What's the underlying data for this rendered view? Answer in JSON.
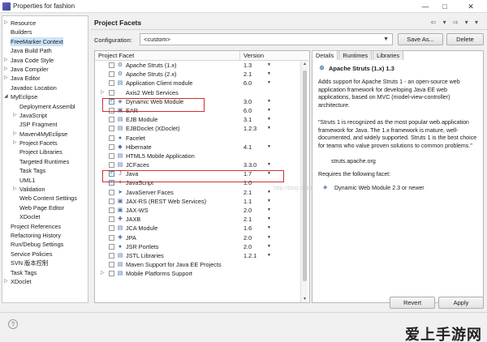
{
  "window": {
    "title": "Properties for fashion",
    "min": "—",
    "max": "□",
    "close": "✕"
  },
  "tree": [
    {
      "label": "Resource",
      "twisty": "▷",
      "indent": 0
    },
    {
      "label": "Builders",
      "twisty": "",
      "indent": 0
    },
    {
      "label": "FreeMarker Context",
      "twisty": "",
      "indent": 0,
      "selected": true
    },
    {
      "label": "Java Build Path",
      "twisty": "",
      "indent": 0
    },
    {
      "label": "Java Code Style",
      "twisty": "▷",
      "indent": 0
    },
    {
      "label": "Java Compiler",
      "twisty": "▷",
      "indent": 0
    },
    {
      "label": "Java Editor",
      "twisty": "▷",
      "indent": 0
    },
    {
      "label": "Javadoc Location",
      "twisty": "",
      "indent": 0
    },
    {
      "label": "MyEclipse",
      "twisty": "◢",
      "indent": 0
    },
    {
      "label": "Deployment Assembl",
      "twisty": "",
      "indent": 1
    },
    {
      "label": "JavaScript",
      "twisty": "▷",
      "indent": 1
    },
    {
      "label": "JSP Fragment",
      "twisty": "",
      "indent": 1
    },
    {
      "label": "Maven4MyEclipse",
      "twisty": "▷",
      "indent": 1
    },
    {
      "label": "Project Facets",
      "twisty": "▷",
      "indent": 1
    },
    {
      "label": "Project Libraries",
      "twisty": "",
      "indent": 1
    },
    {
      "label": "Targeted Runtimes",
      "twisty": "",
      "indent": 1
    },
    {
      "label": "Task Tags",
      "twisty": "",
      "indent": 1
    },
    {
      "label": "UML1",
      "twisty": "",
      "indent": 1
    },
    {
      "label": "Validation",
      "twisty": "▷",
      "indent": 1
    },
    {
      "label": "Web Content Settings",
      "twisty": "",
      "indent": 1
    },
    {
      "label": "Web Page Editor",
      "twisty": "",
      "indent": 1
    },
    {
      "label": "XDoclet",
      "twisty": "",
      "indent": 1
    },
    {
      "label": "Project References",
      "twisty": "",
      "indent": 0
    },
    {
      "label": "Refactoring History",
      "twisty": "",
      "indent": 0
    },
    {
      "label": "Run/Debug Settings",
      "twisty": "",
      "indent": 0
    },
    {
      "label": "Service Policies",
      "twisty": "",
      "indent": 0
    },
    {
      "label": "SVN 版本控制",
      "twisty": "",
      "indent": 0
    },
    {
      "label": "Task Tags",
      "twisty": "",
      "indent": 0
    },
    {
      "label": "XDoclet",
      "twisty": "▷",
      "indent": 0
    }
  ],
  "page": {
    "title": "Project Facets",
    "config_label": "Configuration:",
    "config_value": "<custom>",
    "save_as": "Save As...",
    "delete": "Delete",
    "col_facet": "Project Facet",
    "col_version": "Version"
  },
  "facets": [
    {
      "name": "Apache Struts (1.x)",
      "version": "1.3",
      "checked": false,
      "icon": "⚙",
      "dd": true
    },
    {
      "name": "Apache Struts (2.x)",
      "version": "2.1",
      "checked": false,
      "icon": "⚙",
      "dd": true
    },
    {
      "name": "Application Client module",
      "version": "6.0",
      "checked": false,
      "icon": "▤",
      "dd": true
    },
    {
      "name": "Axis2 Web Services",
      "version": "",
      "checked": false,
      "icon": "",
      "twisty": "▷"
    },
    {
      "name": "Dynamic Web Module",
      "version": "3.0",
      "checked": true,
      "icon": "◈",
      "dd": true
    },
    {
      "name": "EAR",
      "version": "6.0",
      "checked": false,
      "icon": "▣",
      "dd": true
    },
    {
      "name": "EJB Module",
      "version": "3.1",
      "checked": false,
      "icon": "▤",
      "dd": true
    },
    {
      "name": "EJBDoclet (XDoclet)",
      "version": "1.2.3",
      "checked": false,
      "icon": "▤",
      "dd": true
    },
    {
      "name": "Facelet",
      "version": "",
      "checked": false,
      "icon": "●"
    },
    {
      "name": "Hibernate",
      "version": "4.1",
      "checked": false,
      "icon": "◆",
      "dd": true
    },
    {
      "name": "HTML5 Mobile Application",
      "version": "",
      "checked": false,
      "icon": "▤"
    },
    {
      "name": "JCFaces",
      "version": "3.3.0",
      "checked": false,
      "icon": "▤",
      "dd": true
    },
    {
      "name": "Java",
      "version": "1.7",
      "checked": true,
      "icon": "J",
      "dd": true
    },
    {
      "name": "JavaScript",
      "version": "1.0",
      "checked": true,
      "icon": "✦"
    },
    {
      "name": "JavaServer Faces",
      "version": "2.1",
      "checked": false,
      "icon": "➤",
      "dd": true
    },
    {
      "name": "JAX-RS (REST Web Services)",
      "version": "1.1",
      "checked": false,
      "icon": "▣",
      "dd": true
    },
    {
      "name": "JAX-WS",
      "version": "2.0",
      "checked": false,
      "icon": "▣",
      "dd": true
    },
    {
      "name": "JAXB",
      "version": "2.1",
      "checked": false,
      "icon": "✚",
      "dd": true
    },
    {
      "name": "JCA Module",
      "version": "1.6",
      "checked": false,
      "icon": "▤",
      "dd": true
    },
    {
      "name": "JPA",
      "version": "2.0",
      "checked": false,
      "icon": "✚",
      "dd": true
    },
    {
      "name": "JSR Portlets",
      "version": "2.0",
      "checked": false,
      "icon": "●",
      "dd": true
    },
    {
      "name": "JSTL Libraries",
      "version": "1.2.1",
      "checked": false,
      "icon": "▤",
      "dd": true
    },
    {
      "name": "Maven Support for Java EE Projects",
      "version": "",
      "checked": false,
      "icon": "▤"
    },
    {
      "name": "Mobile Platforms Support",
      "version": "",
      "checked": false,
      "icon": "▤",
      "twisty": "▷"
    }
  ],
  "tabs": [
    "Details",
    "Runtimes",
    "Libraries"
  ],
  "details": {
    "heading": "Apache Struts (1.x) 1.3",
    "p1": "Adds support for Apache Struts 1 - an open-source web application framework for developing Java EE web applications, based on MVC (model-view-controller) architecture.",
    "p2": "\"Struts 1 is recognized as the most popular web application framework for Java. The 1.x framework is mature, well-documented, and widely supported. Struts 1 is the best choice for teams who value proven solutions to common problems.\"",
    "p3": "struts.apache.org",
    "requires": "Requires the following facet:",
    "req_item": "Dynamic Web Module 2.3 or newer"
  },
  "footer": {
    "revert": "Revert",
    "apply": "Apply",
    "help": "?",
    "logo": "爱上手游网"
  },
  "watermark": "http://blog.csdn.net/mlnataylor"
}
